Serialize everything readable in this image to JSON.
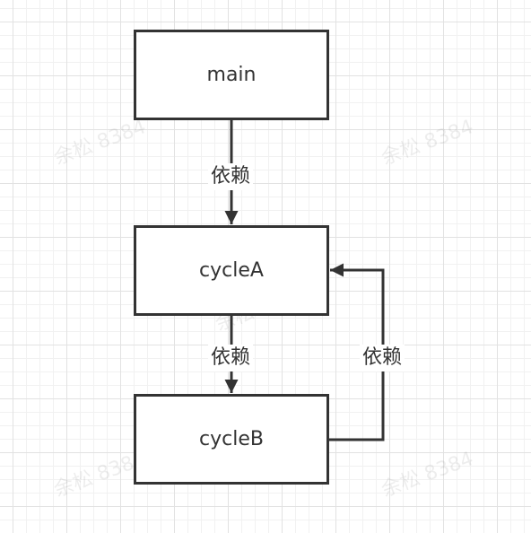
{
  "watermark": "余松 8384",
  "nodes": {
    "main": "main",
    "cycleA": "cycleA",
    "cycleB": "cycleB"
  },
  "edges": {
    "main_to_cycleA": "依赖",
    "cycleA_to_cycleB": "依赖",
    "cycleB_to_cycleA": "依赖"
  },
  "colors": {
    "stroke": "#333333",
    "fill": "#ffffff"
  }
}
